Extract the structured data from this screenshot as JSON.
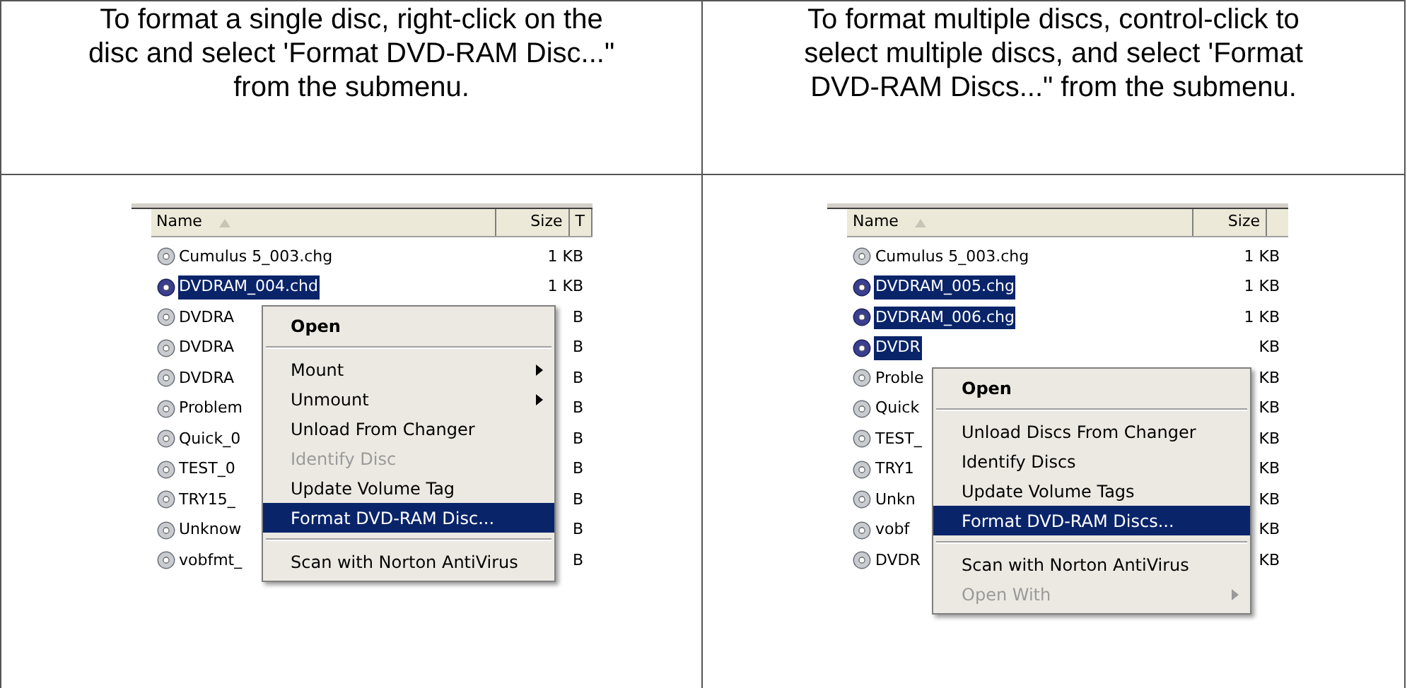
{
  "cells": [
    {
      "caption": "To format a single disc, right-click on the disc and select 'Format DVD-RAM Disc...\" from the submenu.",
      "screenshot": {
        "columns": [
          "Name",
          "Size",
          "T"
        ],
        "files": [
          {
            "name": "Cumulus 5_003.chg",
            "size": "1 KB",
            "selected": false
          },
          {
            "name": "DVDRAM_004.chd",
            "size": "1 KB",
            "selected": true
          },
          {
            "name": "DVDRA",
            "size": "B",
            "selected": false
          },
          {
            "name": "DVDRA",
            "size": "B",
            "selected": false
          },
          {
            "name": "DVDRA",
            "size": "B",
            "selected": false
          },
          {
            "name": "Problem",
            "size": "B",
            "selected": false
          },
          {
            "name": "Quick_0",
            "size": "B",
            "selected": false
          },
          {
            "name": "TEST_0",
            "size": "B",
            "selected": false
          },
          {
            "name": "TRY15_",
            "size": "B",
            "selected": false
          },
          {
            "name": "Unknow",
            "size": "B",
            "selected": false
          },
          {
            "name": "vobfmt_",
            "size": "B",
            "selected": false
          }
        ],
        "menu": {
          "items": [
            {
              "kind": "item",
              "label": "Open",
              "default": true,
              "disabled": false,
              "submenu": false,
              "selected": false
            },
            {
              "kind": "separator"
            },
            {
              "kind": "item",
              "label": "Mount",
              "default": false,
              "disabled": false,
              "submenu": true,
              "selected": false
            },
            {
              "kind": "item",
              "label": "Unmount",
              "default": false,
              "disabled": false,
              "submenu": true,
              "selected": false
            },
            {
              "kind": "item",
              "label": "Unload From Changer",
              "default": false,
              "disabled": false,
              "submenu": false,
              "selected": false
            },
            {
              "kind": "item",
              "label": "Identify Disc",
              "default": false,
              "disabled": true,
              "submenu": false,
              "selected": false
            },
            {
              "kind": "item",
              "label": "Update Volume Tag",
              "default": false,
              "disabled": false,
              "submenu": false,
              "selected": false
            },
            {
              "kind": "item",
              "label": "Format DVD-RAM Disc...",
              "default": false,
              "disabled": false,
              "submenu": false,
              "selected": true
            },
            {
              "kind": "separator"
            },
            {
              "kind": "item",
              "label": "Scan with Norton AntiVirus",
              "default": false,
              "disabled": false,
              "submenu": false,
              "selected": false
            }
          ]
        }
      }
    },
    {
      "caption": "To format multiple discs, control-click to select multiple discs, and select 'Format DVD-RAM Discs...\" from the submenu.",
      "screenshot": {
        "columns": [
          "Name",
          "Size"
        ],
        "files": [
          {
            "name": "Cumulus 5_003.chg",
            "size": "1 KB",
            "selected": false
          },
          {
            "name": "DVDRAM_005.chg",
            "size": "1 KB",
            "selected": true
          },
          {
            "name": "DVDRAM_006.chg",
            "size": "1 KB",
            "selected": true
          },
          {
            "name": "DVDR",
            "size": "KB",
            "selected": true
          },
          {
            "name": "Proble",
            "size": "KB",
            "selected": false
          },
          {
            "name": "Quick",
            "size": "KB",
            "selected": false
          },
          {
            "name": "TEST_",
            "size": "KB",
            "selected": false
          },
          {
            "name": "TRY1",
            "size": "KB",
            "selected": false
          },
          {
            "name": "Unkn",
            "size": "KB",
            "selected": false
          },
          {
            "name": "vobf",
            "size": "KB",
            "selected": false
          },
          {
            "name": "DVDR",
            "size": "KB",
            "selected": false
          }
        ],
        "menu": {
          "items": [
            {
              "kind": "item",
              "label": "Open",
              "default": true,
              "disabled": false,
              "submenu": false,
              "selected": false
            },
            {
              "kind": "separator"
            },
            {
              "kind": "item",
              "label": "Unload Discs From Changer",
              "default": false,
              "disabled": false,
              "submenu": false,
              "selected": false
            },
            {
              "kind": "item",
              "label": "Identify Discs",
              "default": false,
              "disabled": false,
              "submenu": false,
              "selected": false
            },
            {
              "kind": "item",
              "label": "Update Volume Tags",
              "default": false,
              "disabled": false,
              "submenu": false,
              "selected": false
            },
            {
              "kind": "item",
              "label": "Format DVD-RAM Discs...",
              "default": false,
              "disabled": false,
              "submenu": false,
              "selected": true
            },
            {
              "kind": "separator"
            },
            {
              "kind": "item",
              "label": "Scan with Norton AntiVirus",
              "default": false,
              "disabled": false,
              "submenu": false,
              "selected": false
            },
            {
              "kind": "item",
              "label": "Open With",
              "default": false,
              "disabled": true,
              "submenu": true,
              "selected": false
            }
          ]
        }
      }
    }
  ]
}
